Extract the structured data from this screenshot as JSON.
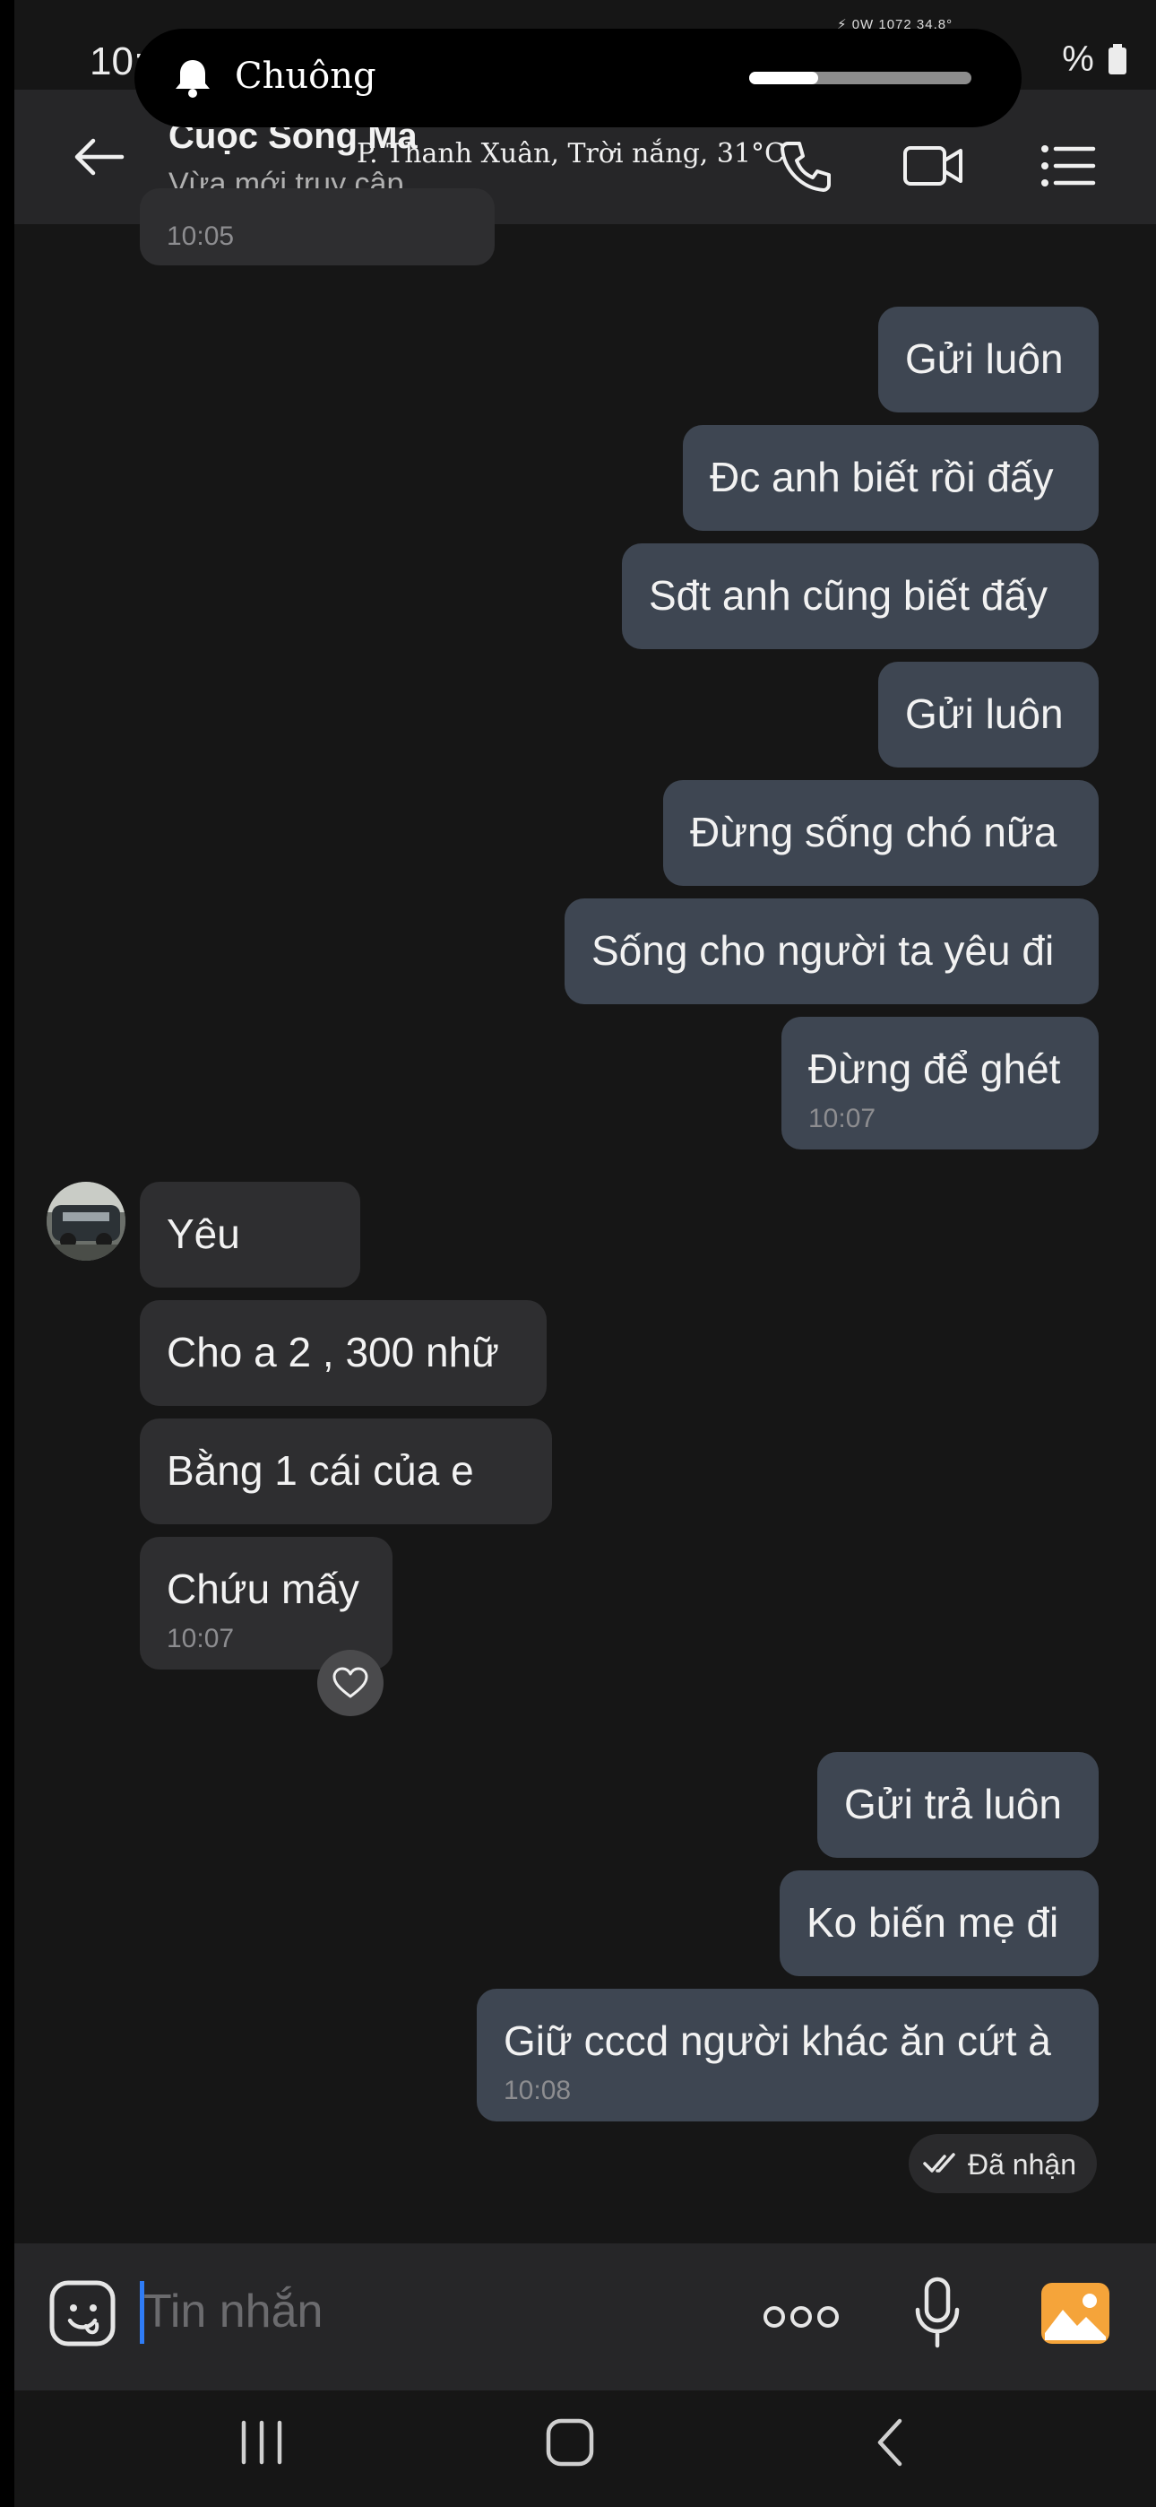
{
  "status_bar": {
    "time": "10:",
    "battery": "%",
    "tiny_readout": "⚡ 0W  1072  34.8°"
  },
  "notification": {
    "label": "Chuông",
    "volume_level": 0.31
  },
  "header": {
    "contact_name": "Cuộc Sống Mà",
    "status": "Vừa mới truy cập",
    "weather": "P. Thanh Xuân, Trời nắng, 31°C",
    "icons": [
      "back-arrow-icon",
      "phone-icon",
      "video-call-icon",
      "menu-list-icon"
    ]
  },
  "messages": [
    {
      "dir": "in",
      "text": "",
      "time": "10:05"
    },
    {
      "dir": "out",
      "text": "Gửi luôn",
      "time": ""
    },
    {
      "dir": "out",
      "text": "Đc anh biết rồi đấy",
      "time": ""
    },
    {
      "dir": "out",
      "text": "Sđt anh cũng biết đấy",
      "time": ""
    },
    {
      "dir": "out",
      "text": "Gửi luôn",
      "time": ""
    },
    {
      "dir": "out",
      "text": "Đừng sống chó nữa",
      "time": ""
    },
    {
      "dir": "out",
      "text": "Sống cho người ta yêu đi",
      "time": ""
    },
    {
      "dir": "out",
      "text": "Đừng để ghét",
      "time": "10:07"
    },
    {
      "dir": "in",
      "text": "Yêu",
      "time": ""
    },
    {
      "dir": "in",
      "text": "Cho a 2 , 300 nhữ",
      "time": ""
    },
    {
      "dir": "in",
      "text": "Bằng 1 cái của e",
      "time": ""
    },
    {
      "dir": "in",
      "text": "Chứu mấy",
      "time": "10:07"
    },
    {
      "dir": "out",
      "text": "Gửi trả luôn",
      "time": ""
    },
    {
      "dir": "out",
      "text": "Ko biến mẹ đi",
      "time": ""
    },
    {
      "dir": "out",
      "text": "Giữ cccd người khác ăn cứt à",
      "time": "10:08"
    }
  ],
  "received_label": "Đã nhận",
  "composer": {
    "placeholder": "Tin nhắn",
    "icons": [
      "sticker-icon",
      "more-icon",
      "microphone-icon",
      "image-icon"
    ]
  },
  "navbar": {
    "icons": [
      "recent-apps-icon",
      "home-icon",
      "back-icon"
    ]
  },
  "colors": {
    "background": "#161616",
    "header": "#262628",
    "outgoing_bubble": "#3e4652",
    "incoming_bubble": "#2e2e30",
    "caret": "#2f7cf6",
    "image_icon": "#f5a43a"
  }
}
